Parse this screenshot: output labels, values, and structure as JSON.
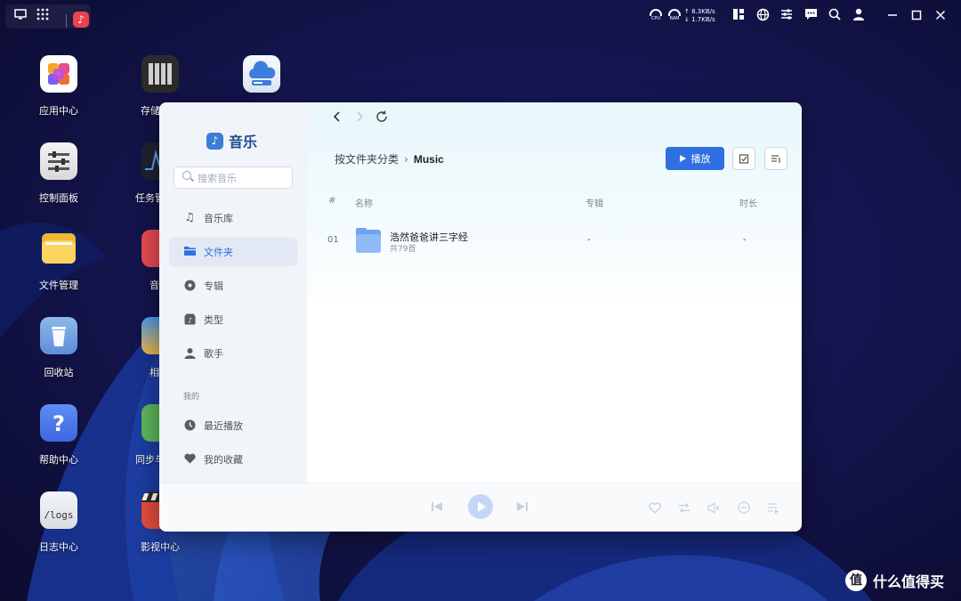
{
  "taskbar": {
    "net_up": "↑ 8.3KB/s",
    "net_down": "↓ 1.7KB/s",
    "cpu_label": "CPU",
    "ram_label": "RAM"
  },
  "desktop": {
    "icons": [
      {
        "label": "应用中心"
      },
      {
        "label": "存储"
      },
      {
        "label": "控制面板"
      },
      {
        "label": "任务管"
      },
      {
        "label": "文件管理"
      },
      {
        "label": "音"
      },
      {
        "label": "回收站"
      },
      {
        "label": "相"
      },
      {
        "label": "帮助中心"
      },
      {
        "label": "同步与"
      },
      {
        "label": "日志中心"
      },
      {
        "label": "影视中心"
      }
    ],
    "logs_tile_text": "/logs"
  },
  "music_app": {
    "brand": "音乐",
    "search_placeholder": "搜索音乐",
    "nav": [
      {
        "label": "音乐库"
      },
      {
        "label": "文件夹"
      },
      {
        "label": "专辑"
      },
      {
        "label": "类型"
      },
      {
        "label": "歌手"
      }
    ],
    "section_mine": "我的",
    "mine": [
      {
        "label": "最近播放"
      },
      {
        "label": "我的收藏"
      }
    ],
    "breadcrumb": {
      "parent": "按文件夹分类",
      "current": "Music"
    },
    "play_button": "播放",
    "help_glyph": "?",
    "columns": {
      "index": "#",
      "name": "名称",
      "album": "专辑",
      "duration": "时长"
    },
    "rows": [
      {
        "index": "01",
        "title": "浩然爸爸讲三字经",
        "subtitle": "共79首",
        "album": "-",
        "duration": "-"
      }
    ]
  },
  "watermark": {
    "badge": "值",
    "text": "什么值得买"
  }
}
